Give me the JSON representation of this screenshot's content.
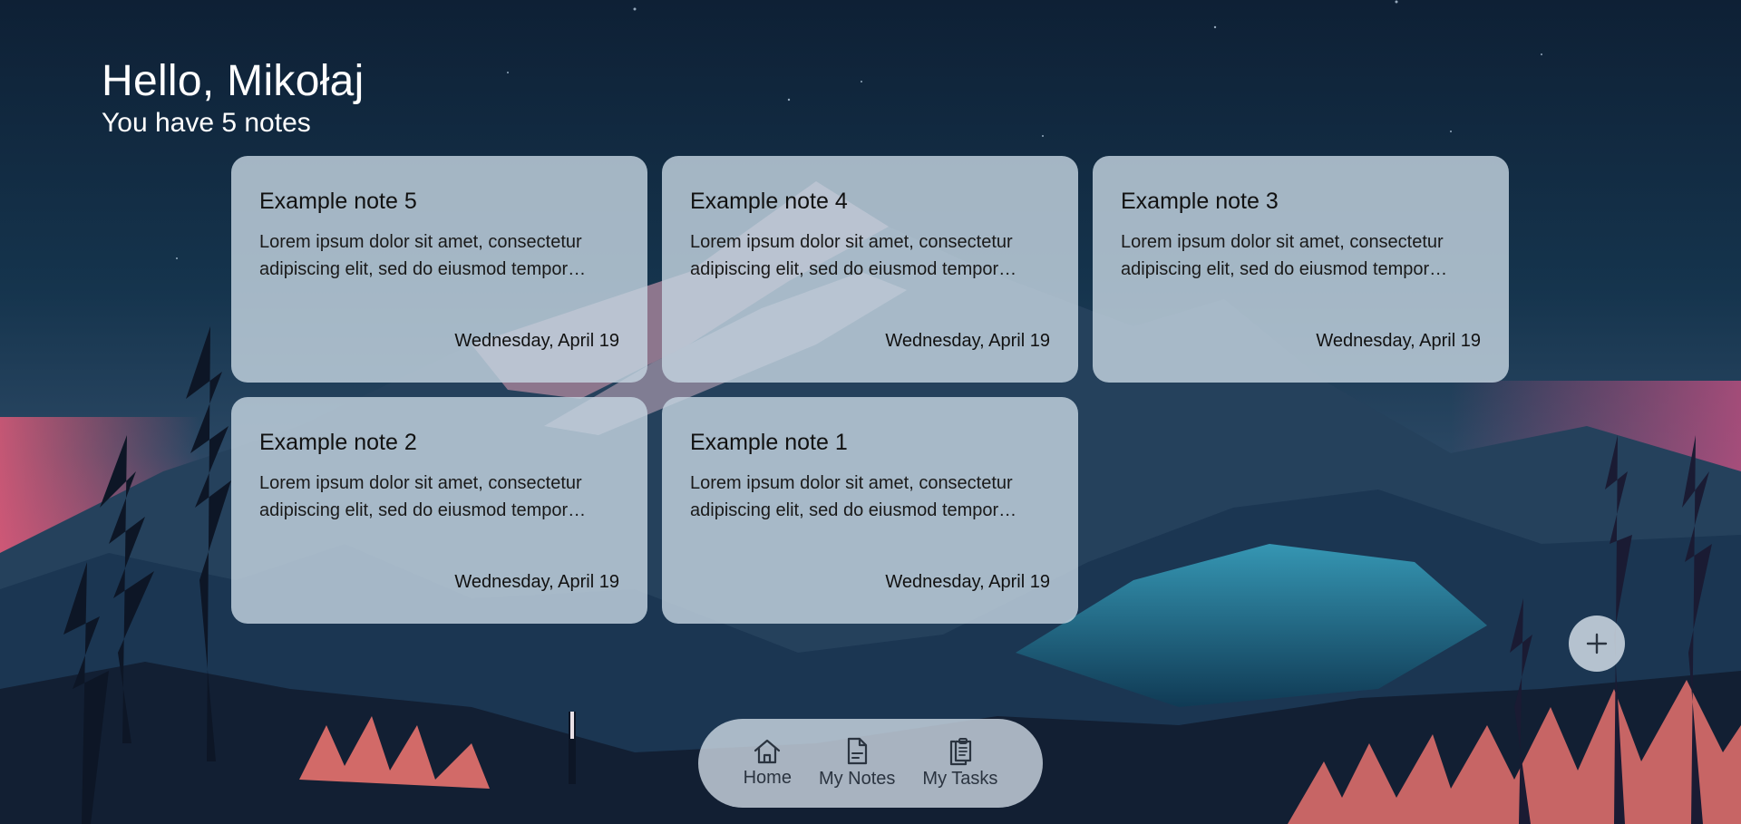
{
  "header": {
    "greeting": "Hello, Mikołaj",
    "subtitle": "You have 5 notes"
  },
  "notes": [
    {
      "title": "Example note 5",
      "body": "Lorem ipsum dolor sit amet, consectetur adipiscing elit, sed do eiusmod tempor…",
      "date": "Wednesday, April 19"
    },
    {
      "title": "Example note 4",
      "body": "Lorem ipsum dolor sit amet, consectetur adipiscing elit, sed do eiusmod tempor…",
      "date": "Wednesday, April 19"
    },
    {
      "title": "Example note 3",
      "body": "Lorem ipsum dolor sit amet, consectetur adipiscing elit, sed do eiusmod tempor…",
      "date": "Wednesday, April 19"
    },
    {
      "title": "Example note 2",
      "body": "Lorem ipsum dolor sit amet, consectetur adipiscing elit, sed do eiusmod tempor…",
      "date": "Wednesday, April 19"
    },
    {
      "title": "Example note 1",
      "body": "Lorem ipsum dolor sit amet, consectetur adipiscing elit, sed do eiusmod tempor…",
      "date": "Wednesday, April 19"
    }
  ],
  "fab": {
    "icon": "plus-icon"
  },
  "bottom_nav": {
    "items": [
      {
        "label": "Home",
        "icon": "home-icon"
      },
      {
        "label": "My Notes",
        "icon": "document-icon"
      },
      {
        "label": "My Tasks",
        "icon": "clipboard-icon"
      }
    ]
  },
  "colors": {
    "card_background": "#c4d4e0",
    "nav_background": "#d2dee8",
    "text_primary": "#111111",
    "header_text": "#ffffff"
  }
}
